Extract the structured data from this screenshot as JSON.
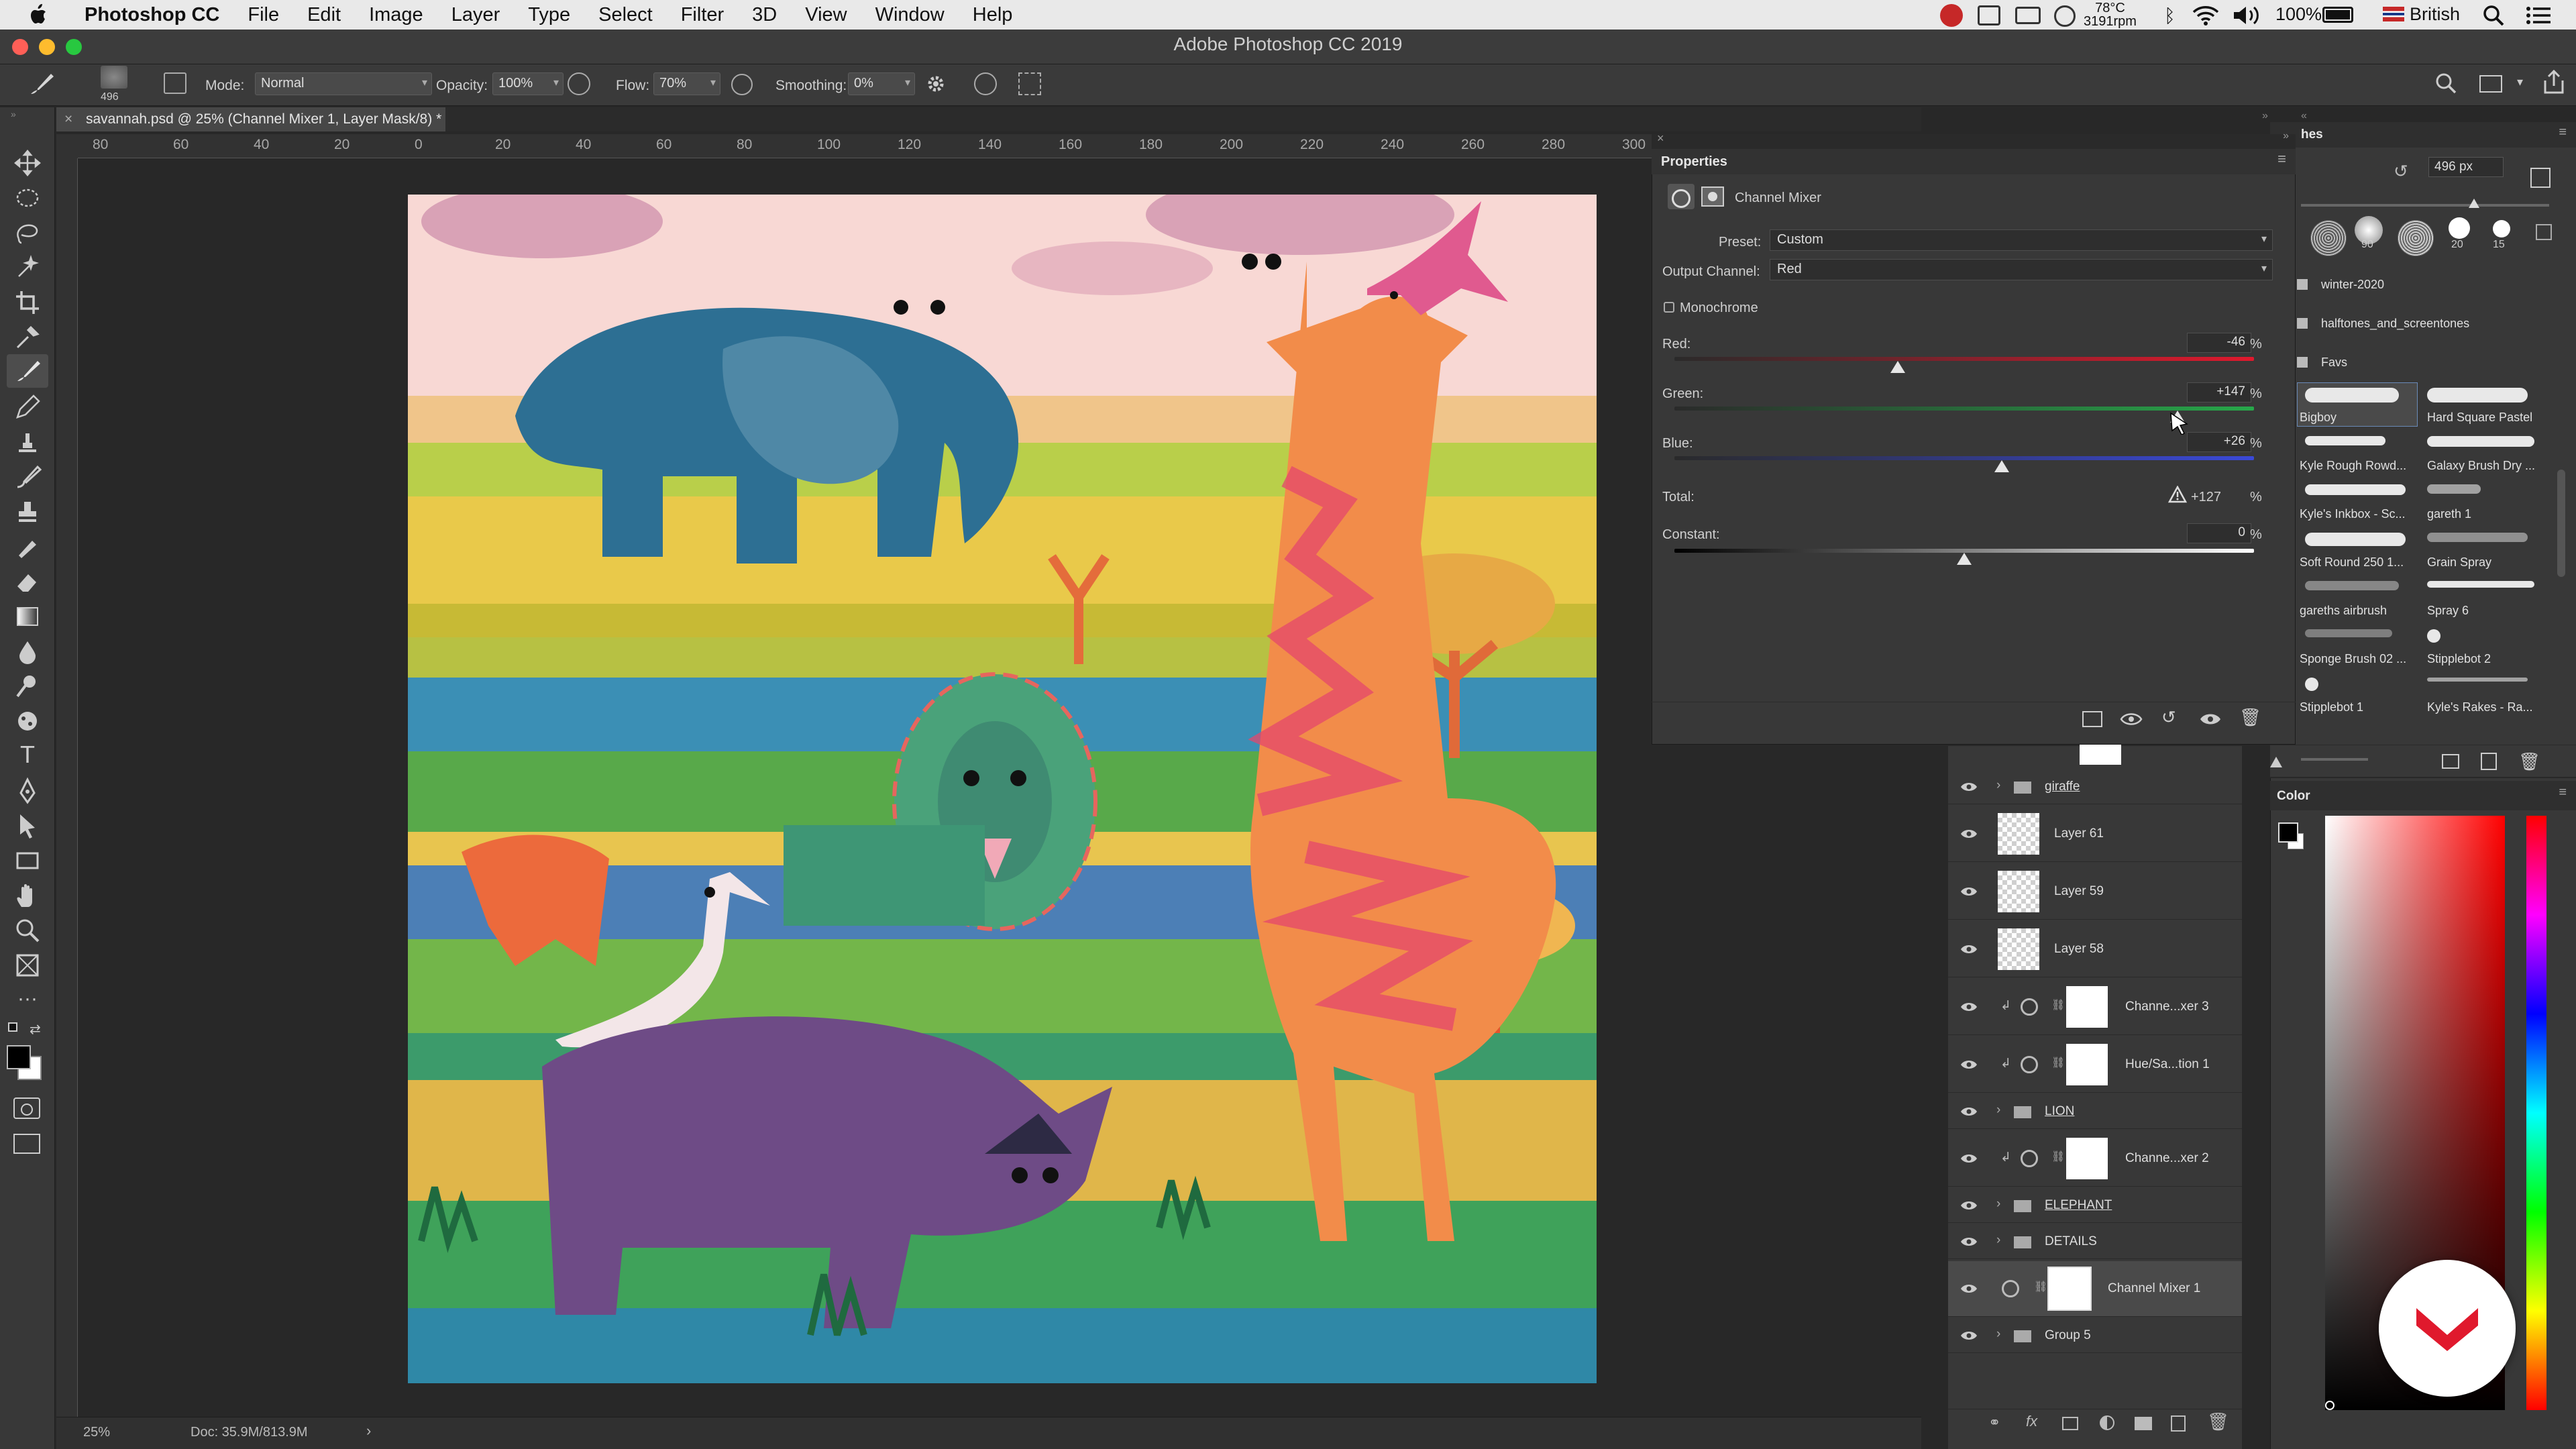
{
  "menubar": {
    "app_name": "Photoshop CC",
    "items": [
      "File",
      "Edit",
      "Image",
      "Layer",
      "Type",
      "Select",
      "Filter",
      "3D",
      "View",
      "Window",
      "Help"
    ],
    "status": {
      "temp": "78°C",
      "rpm": "3191rpm",
      "battery": "100%",
      "input_source": "British"
    }
  },
  "window": {
    "title": "Adobe Photoshop CC 2019"
  },
  "options_bar": {
    "brush_size": "496",
    "mode_label": "Mode:",
    "mode_value": "Normal",
    "opacity_label": "Opacity:",
    "opacity_value": "100%",
    "flow_label": "Flow:",
    "flow_value": "70%",
    "smoothing_label": "Smoothing:",
    "smoothing_value": "0%"
  },
  "document": {
    "tab_title": "savannah.psd @ 25% (Channel Mixer 1, Layer Mask/8) *"
  },
  "ruler": {
    "h_labels": [
      "80",
      "60",
      "40",
      "20",
      "0",
      "20",
      "40",
      "60",
      "80",
      "100",
      "120",
      "140",
      "160",
      "180",
      "200",
      "220",
      "240",
      "260",
      "280",
      "300"
    ]
  },
  "statusbar": {
    "zoom": "25%",
    "doc": "Doc: 35.9M/813.9M"
  },
  "properties": {
    "title": "Properties",
    "adjustment_name": "Channel Mixer",
    "preset_label": "Preset:",
    "preset_value": "Custom",
    "output_label": "Output Channel:",
    "output_value": "Red",
    "monochrome_label": "Monochrome",
    "red_label": "Red:",
    "red_value": "-46",
    "red_level": -46,
    "green_label": "Green:",
    "green_value": "+147",
    "green_level": 147,
    "blue_label": "Blue:",
    "blue_value": "+26",
    "blue_level": 26,
    "total_label": "Total:",
    "total_value": "+127",
    "constant_label": "Constant:",
    "constant_value": "0",
    "constant_level": 0,
    "percent": "%"
  },
  "brushes": {
    "tab_label": "hes",
    "size_value": "496 px",
    "tip_sizes": [
      "90",
      "20",
      "15"
    ],
    "folders": [
      "winter-2020",
      "halftones_and_screentones",
      "Favs"
    ],
    "items": [
      [
        "Bigboy",
        "Hard Square Pastel"
      ],
      [
        "Kyle Rough Rowd...",
        "Galaxy Brush Dry ..."
      ],
      [
        "Kyle's Inkbox - Sc...",
        "gareth 1"
      ],
      [
        "Soft Round 250 1...",
        "Grain Spray"
      ],
      [
        "gareths airbrush",
        "Spray 6"
      ],
      [
        "Sponge Brush 02 ...",
        "Stipplebot 2"
      ],
      [
        "Stipplebot 1",
        "Kyle's Rakes - Ra..."
      ]
    ]
  },
  "layers": [
    {
      "name": "giraffe",
      "kind": "group"
    },
    {
      "name": "Layer 61",
      "kind": "layer"
    },
    {
      "name": "Layer 59",
      "kind": "layer"
    },
    {
      "name": "Layer 58",
      "kind": "layer"
    },
    {
      "name": "Channe...xer 3",
      "kind": "adjustment"
    },
    {
      "name": "Hue/Sa...tion 1",
      "kind": "adjustment"
    },
    {
      "name": "LION",
      "kind": "group"
    },
    {
      "name": "Channe...xer 2",
      "kind": "adjustment"
    },
    {
      "name": "ELEPHANT",
      "kind": "group"
    },
    {
      "name": "DETAILS",
      "kind": "group"
    },
    {
      "name": "Channel Mixer 1",
      "kind": "adjustment",
      "selected": true
    },
    {
      "name": "Group 5",
      "kind": "group"
    }
  ],
  "color_panel": {
    "title": "Color"
  },
  "colors": {
    "accent_red": "#e0192d",
    "selection": "#4a4a4a"
  }
}
